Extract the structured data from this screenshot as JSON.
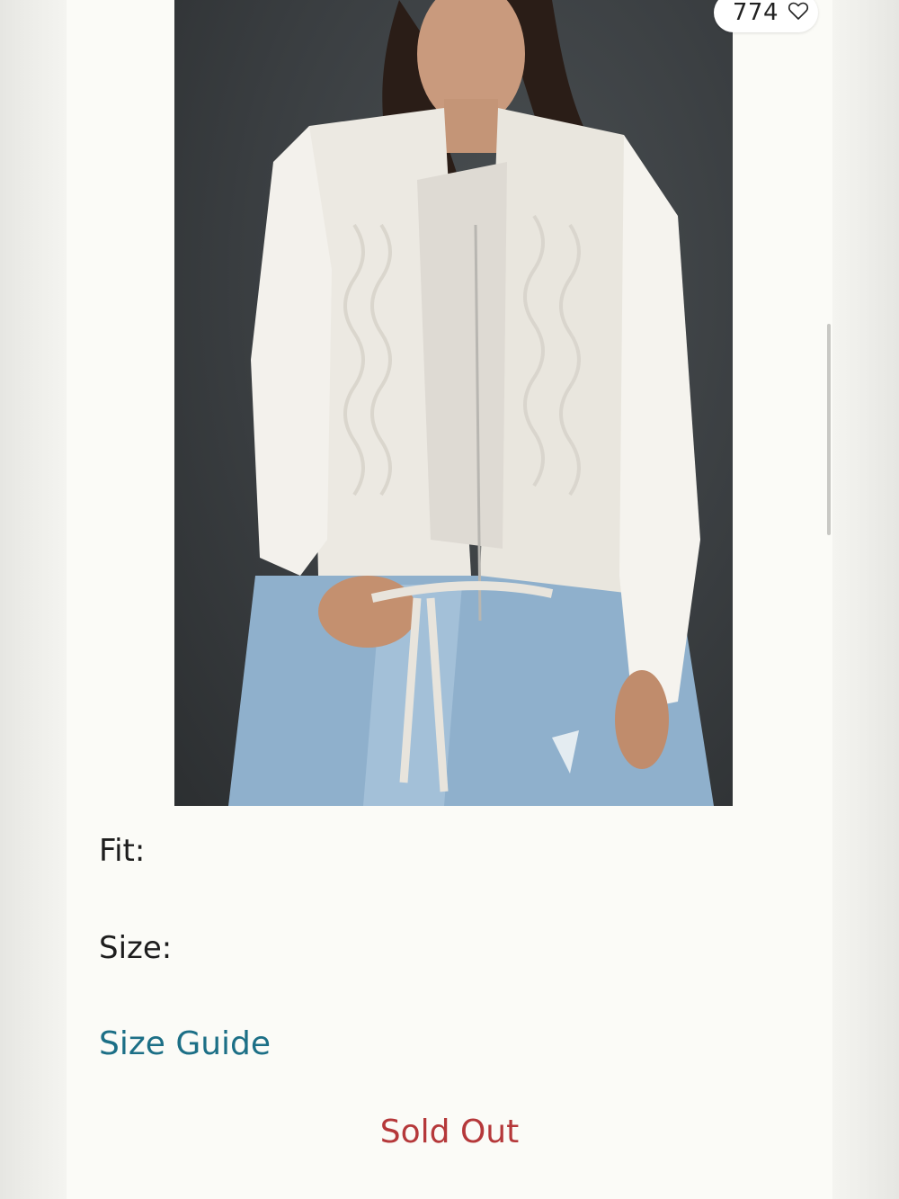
{
  "product": {
    "likes_count": "774",
    "image_alt": "Model wearing a white cable-knit quilted jacket over a white henley with light-wash jeans",
    "fit_label": "Fit:",
    "size_label": "Size:",
    "size_guide_label": "Size Guide",
    "status_label": "Sold Out"
  },
  "icons": {
    "like": "heart-outline-icon"
  },
  "colors": {
    "link": "#1c6f86",
    "sold_out": "#b5383a",
    "background": "#fbfbf7"
  }
}
